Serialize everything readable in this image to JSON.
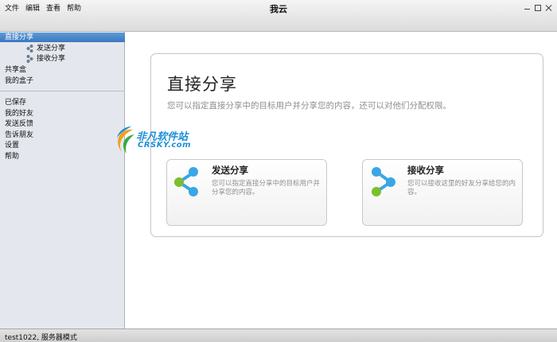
{
  "window": {
    "title": "我云"
  },
  "menu": [
    "文件",
    "编辑",
    "查看",
    "帮助"
  ],
  "sidebar": {
    "items": [
      {
        "label": "直接分享",
        "selected": true
      },
      {
        "label": "发送分享",
        "icon": "send-share-icon"
      },
      {
        "label": "接收分享",
        "icon": "receive-share-icon"
      },
      {
        "label": "共享盒"
      },
      {
        "label": "我的盒子"
      }
    ],
    "items2": [
      {
        "label": "已保存"
      },
      {
        "label": "我的好友"
      },
      {
        "label": "发送反馈"
      },
      {
        "label": "告诉朋友"
      },
      {
        "label": "设置"
      },
      {
        "label": "帮助"
      }
    ]
  },
  "main": {
    "title": "直接分享",
    "description": "您可以指定直接分享中的目标用户并分享您的内容，还可以对他们分配权限。",
    "cards": [
      {
        "title": "发送分享",
        "desc": "您可以指定直接分享中的目标用户并分享您的内容。",
        "icon": "send-share-icon"
      },
      {
        "title": "接收分享",
        "desc": "您可以接收这里的好友分享给您的内容。",
        "icon": "receive-share-icon"
      }
    ]
  },
  "watermark": {
    "main": "非凡软件站",
    "sub": "CRSKY.com"
  },
  "status": {
    "text": "test1022, 服务器模式"
  },
  "colors": {
    "selection": "#3b78bf",
    "sidebar_bg": "#e4e8ee",
    "icon_blue": "#39a6e6",
    "icon_green": "#7cbf2e"
  }
}
